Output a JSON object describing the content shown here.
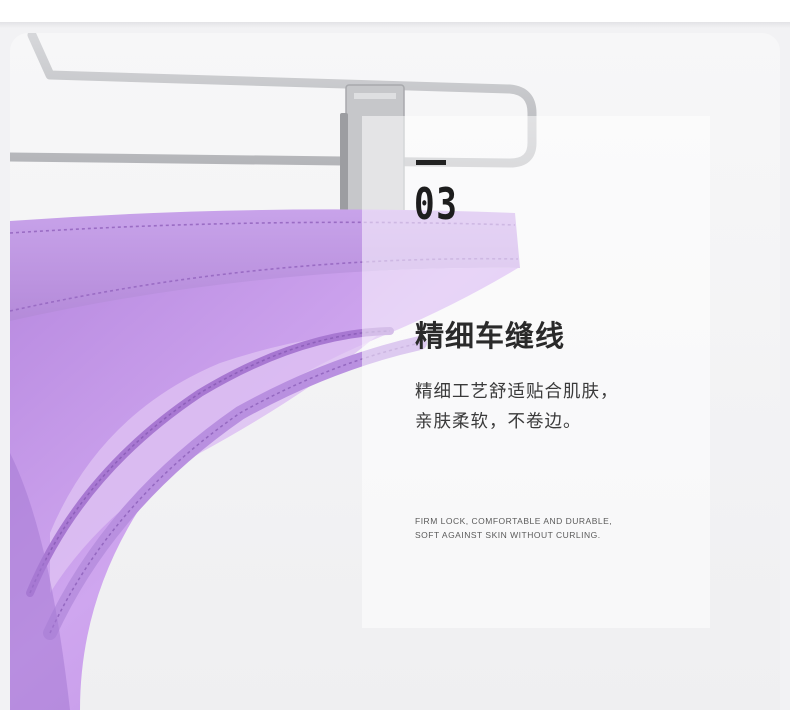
{
  "section": {
    "number": "03",
    "heading": "精细车缝线",
    "description_lines": [
      "精细工艺舒适贴合肌肤，",
      "亲肤柔软，不卷边。"
    ],
    "english_lines": [
      "FIRM LOCK, COMFORTABLE AND DURABLE,",
      "SOFT AGAINST SKIN WITHOUT CURLING."
    ]
  },
  "colors": {
    "fabric": "#c59ae8",
    "fabric_light": "#ddbff2",
    "fabric_stitch": "#9a6cc4",
    "hanger": "#c9cacd",
    "background": "#f2f2f4",
    "text_dark": "#222222"
  }
}
